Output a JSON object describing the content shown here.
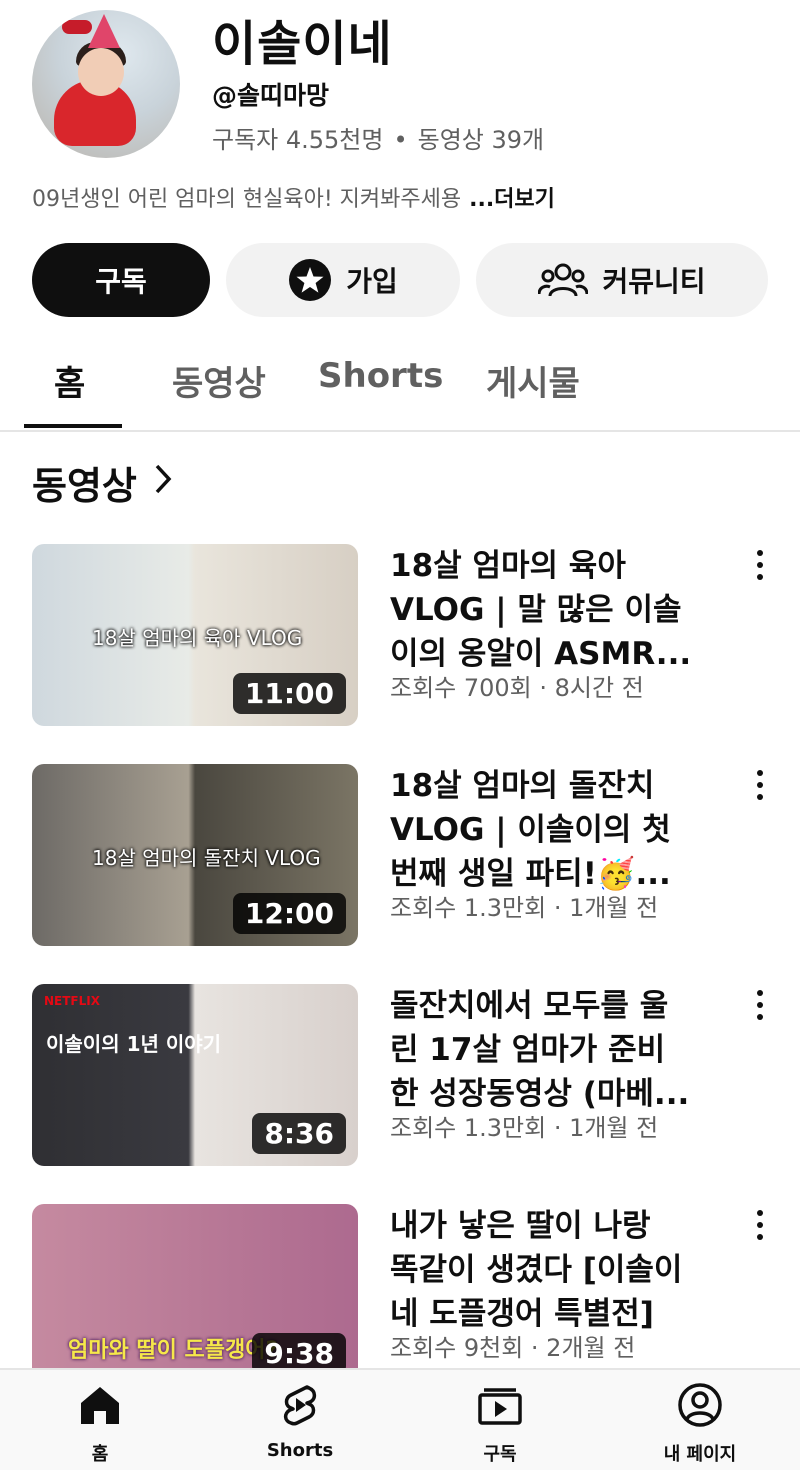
{
  "channel": {
    "name": "이솔이네",
    "handle": "@솔띠마망",
    "subscribers": "구독자 4.55천명",
    "video_count": "동영상 39개",
    "description": "09년생인 어린 엄마의 현실육아! 지켜봐주세용",
    "more_label": "...더보기"
  },
  "actions": {
    "subscribe_label": "구독",
    "join_label": "가입",
    "community_label": "커뮤니티"
  },
  "tabs": [
    {
      "label": "홈",
      "active": true
    },
    {
      "label": "동영상",
      "active": false
    },
    {
      "label": "Shorts",
      "active": false
    },
    {
      "label": "게시물",
      "active": false
    }
  ],
  "section": {
    "title": "동영상"
  },
  "videos": [
    {
      "title_lines": [
        "18살 엄마의 육아",
        "VLOG | 말 많은 이솔",
        "이의 옹알이 ASMR..."
      ],
      "meta": "조회수 700회 · 8시간 전",
      "duration": "11:00",
      "thumb_caption": "18살 엄마의 육아 VLOG"
    },
    {
      "title_lines": [
        "18살 엄마의 돌잔치",
        "VLOG | 이솔이의 첫",
        "번째 생일 파티!🥳..."
      ],
      "meta": "조회수 1.3만회 · 1개월 전",
      "duration": "12:00",
      "thumb_caption": "18살 엄마의 돌잔치 VLOG"
    },
    {
      "title_lines": [
        "돌잔치에서 모두를 울",
        "린 17살 엄마가 준비",
        "한 성장동영상 (마베..."
      ],
      "meta": "조회수 1.3만회 · 1개월 전",
      "duration": "8:36",
      "thumb_caption": "이솔이의 1년 이야기",
      "thumb_brand": "NETFLIX"
    },
    {
      "title_lines": [
        "내가 낳은 딸이 나랑",
        "똑같이 생겼다 [이솔이",
        "네 도플갱어 특별전]"
      ],
      "meta": "조회수 9천회 · 2개월 전",
      "duration": "9:38",
      "thumb_caption": "엄마와 딸이 도플갱어?"
    }
  ],
  "bottom_nav": [
    {
      "label": "홈",
      "icon": "home-icon"
    },
    {
      "label": "Shorts",
      "icon": "shorts-icon"
    },
    {
      "label": "구독",
      "icon": "subscriptions-icon"
    },
    {
      "label": "내 페이지",
      "icon": "account-icon"
    }
  ]
}
